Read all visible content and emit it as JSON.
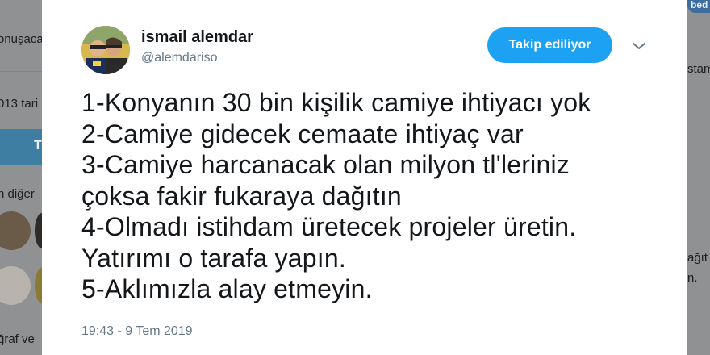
{
  "background": {
    "left_texts": [
      "onuşaca",
      "013 tari",
      "n diğer",
      "ğraf ve"
    ],
    "left_button_label": "T",
    "right_texts": [
      "stam",
      "ağıt",
      "n."
    ],
    "logo_text": "bed"
  },
  "tweet": {
    "author_name": "ismail alemdar",
    "author_handle": "@alemdariso",
    "follow_button_label": "Takip ediliyor",
    "lines": [
      "1-Konyanın 30 bin kişilik camiye ihtiyacı yok",
      "2-Camiye gidecek cemaate ihtiyaç var",
      "3-Camiye harcanacak olan milyon tl'leriniz",
      "çoksa fakir fukaraya dağıtın",
      "4-Olmadı istihdam üretecek projeler üretin.",
      "Yatırımı o tarafa yapın.",
      "5-Aklımızla alay etmeyin."
    ],
    "timestamp": "19:43 - 9 Tem 2019"
  },
  "icons": {
    "more_menu": "chevron-down-icon"
  },
  "colors": {
    "follow_button": "#1da1f2",
    "text_primary": "#14171a",
    "text_secondary": "#657786"
  }
}
